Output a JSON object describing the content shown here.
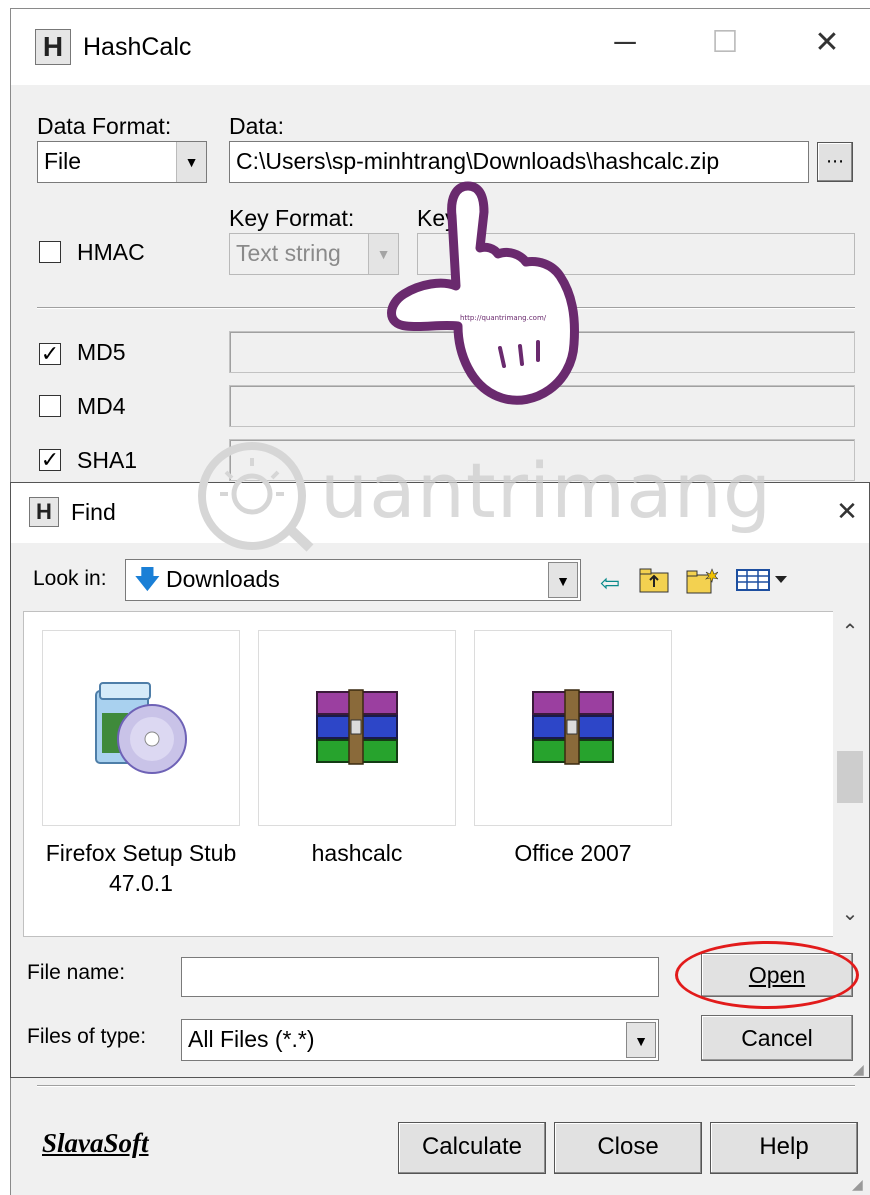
{
  "hashcalc": {
    "title": "HashCalc",
    "app_icon": "H",
    "window_controls": {
      "minimize": "─",
      "maximize": "☐",
      "close": "✕"
    },
    "data_format": {
      "label": "Data Format:",
      "value": "File"
    },
    "data": {
      "label": "Data:",
      "value": "C:\\Users\\sp-minhtrang\\Downloads\\hashcalc.zip"
    },
    "hmac": {
      "label": "HMAC",
      "checked": false
    },
    "key_format": {
      "label": "Key Format:",
      "value": "Text string"
    },
    "key": {
      "label": "Key"
    },
    "hashes": [
      {
        "label": "MD5",
        "checked": true
      },
      {
        "label": "MD4",
        "checked": false
      },
      {
        "label": "SHA1",
        "checked": true
      }
    ],
    "brand": "SlavaSoft",
    "buttons": {
      "calculate": "Calculate",
      "close": "Close",
      "help": "Help"
    }
  },
  "find": {
    "title": "Find",
    "icon": "H",
    "close": "✕",
    "look_in": {
      "label": "Look in:",
      "value": "Downloads"
    },
    "toolbar_icons": [
      "back-arrow-icon",
      "up-folder-icon",
      "new-folder-icon",
      "view-menu-icon"
    ],
    "files": [
      {
        "name": "Firefox Setup Stub\n47.0.1",
        "icon": "installer-icon"
      },
      {
        "name": "hashcalc",
        "icon": "winrar-archive-icon"
      },
      {
        "name": "Office 2007",
        "icon": "winrar-archive-icon"
      }
    ],
    "file_name": {
      "label": "File name:",
      "value": ""
    },
    "files_of_type": {
      "label": "Files of type:",
      "value": "All Files (*.*)"
    },
    "buttons": {
      "open": "Open",
      "cancel": "Cancel"
    }
  },
  "watermark": {
    "text": "uantrimang",
    "small_url": "http://quantrimang.com/"
  },
  "colors": {
    "highlight_oval": "#e21b1b",
    "hand_outline": "#6a2a6e",
    "watermark": "#cfcfcf"
  }
}
